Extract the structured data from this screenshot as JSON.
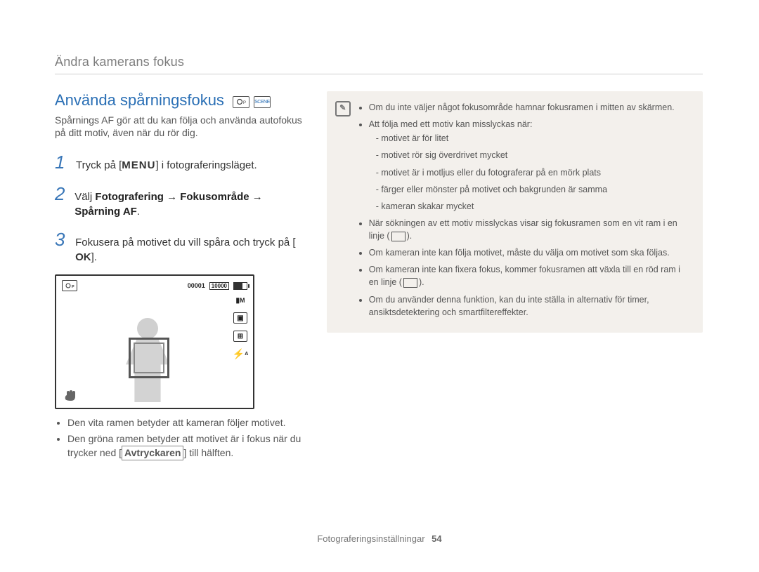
{
  "header": {
    "breadcrumb": "Ändra kamerans fokus"
  },
  "section": {
    "title": "Använda spårningsfokus",
    "mode_icons": [
      "program-mode-icon",
      "scene-mode-icon"
    ],
    "intro": "Spårnings AF gör att du kan följa och använda autofokus på ditt motiv, även när du rör dig."
  },
  "steps": [
    {
      "num": "1",
      "prefix": "Tryck på [",
      "button": "MENU",
      "suffix": "] i fotograferingsläget."
    },
    {
      "num": "2",
      "prefix": "Välj ",
      "bold": "Fotografering → Fokusområde → Spårning AF",
      "suffix": "."
    },
    {
      "num": "3",
      "prefix": "Fokusera på motivet du vill spåra och tryck på [",
      "button": "OK",
      "suffix": "]."
    }
  ],
  "illustration": {
    "counter": "00001",
    "size_label": "10000",
    "side_icons": [
      "M",
      "grid1",
      "grid2",
      "flash"
    ]
  },
  "bullets_left": [
    "Den vita ramen betyder att kameran följer motivet.",
    {
      "pre": "Den gröna ramen betyder att motivet är i fokus när du trycker ned [",
      "btn": "Avtryckaren",
      "post": "] till hälften."
    }
  ],
  "infobox": {
    "items": [
      "Om du inte väljer något fokusområde hamnar fokusramen i mitten av skärmen.",
      {
        "text": "Att följa med ett motiv kan misslyckas när:",
        "sub": [
          "motivet är för litet",
          "motivet rör sig överdrivet mycket",
          "motivet är i motljus eller du fotograferar på en mörk plats",
          "färger eller mönster på motivet och bakgrunden är samma",
          "kameran skakar mycket"
        ]
      },
      {
        "text_with_frame": [
          "När sökningen av ett motiv misslyckas visar sig fokusramen som en vit ram i en linje (",
          ")."
        ]
      },
      "Om kameran inte kan följa motivet, måste du välja om motivet som ska följas.",
      {
        "text_with_frame": [
          "Om kameran inte kan fixera fokus, kommer fokusramen att växla till en röd ram i en linje (",
          ")."
        ]
      },
      "Om du använder denna funktion, kan du inte ställa in alternativ för timer, ansiktsdetektering och smartfiltereffekter."
    ]
  },
  "footer": {
    "label": "Fotograferingsinställningar",
    "page": "54"
  }
}
